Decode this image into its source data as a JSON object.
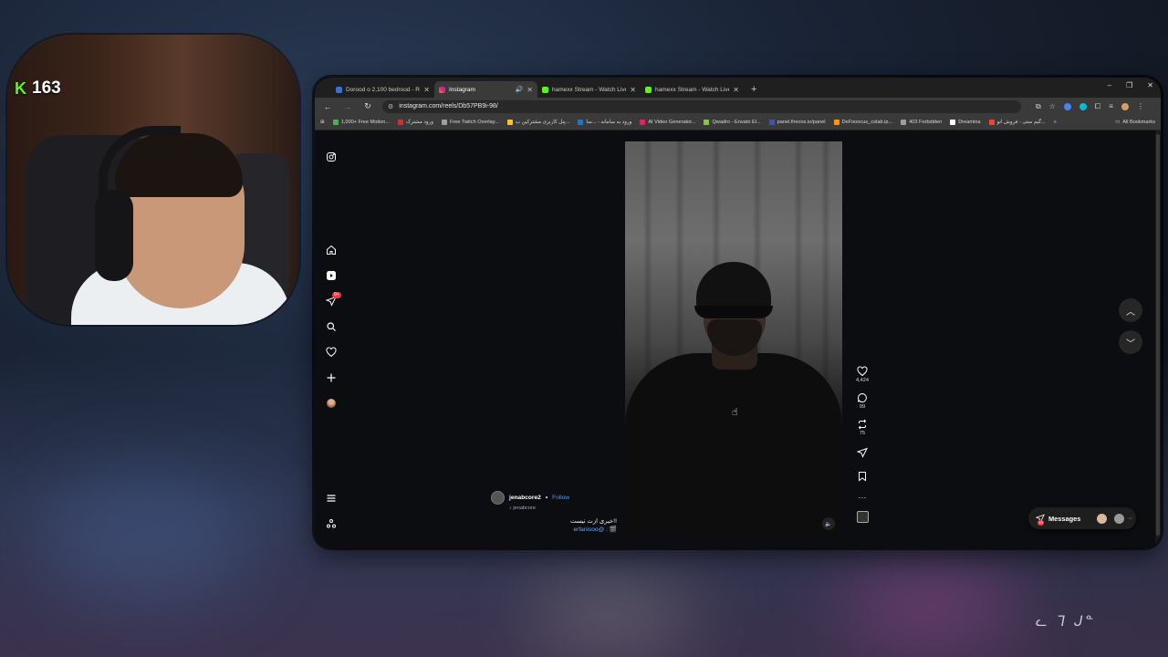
{
  "stream_overlay": {
    "viewer_count": "163",
    "kick_logo": "K",
    "corner_watermark": "ᓚ ᒣ ᒍᓐ"
  },
  "browser": {
    "tabs": [
      {
        "label": "Dorood o 2,100 bedrood - Re...",
        "favicon_color": "#3b6fd6",
        "active": false
      },
      {
        "label": "Instagram",
        "favicon_color": "#e1306c",
        "active": true
      },
      {
        "label": "hamexx Stream - Watch Live o...",
        "favicon_color": "#53fc18",
        "active": false
      },
      {
        "label": "hamexx Stream - Watch Live o...",
        "favicon_color": "#53fc18",
        "active": false
      }
    ],
    "url": "instagram.com/reels/Db57PB9i-98/",
    "bookmarks": [
      {
        "label": "1,000+ Free Motion...",
        "color": "#4caf50"
      },
      {
        "label": "ورود مشترک",
        "color": "#d32f2f"
      },
      {
        "label": "Free Twitch Overlay...",
        "color": "#9e9e9e"
      },
      {
        "label": "پنل کاربری مشترکین ب...",
        "color": "#fbc02d"
      },
      {
        "label": "ورود به سامانه - ...سا",
        "color": "#1976d2"
      },
      {
        "label": "AI Video Generator...",
        "color": "#e91e63"
      },
      {
        "label": "Qwadro - Envato El...",
        "color": "#8bc34a"
      },
      {
        "label": "panel.firecos.io/panel",
        "color": "#3f51b5"
      },
      {
        "label": "DeFooocus_colab.ip...",
        "color": "#ff9800"
      },
      {
        "label": "403 Forbidden",
        "color": "#9e9e9e"
      },
      {
        "label": "Dreamina",
        "color": "#ffffff"
      },
      {
        "label": "گیم ستی - فروش انو...",
        "color": "#f44336"
      }
    ],
    "all_bookmarks": "All Bookmarks"
  },
  "instagram": {
    "sidebar_badge": "9+",
    "reel": {
      "username": "jenabcore2",
      "follow": "Follow",
      "audio": "jenabcore",
      "caption": "خبری ازت نیست!!",
      "mention": "erfanisoo@ : 🎬",
      "likes": "4,424",
      "comments": "99",
      "reposts": "75"
    },
    "messages": {
      "label": "Messages",
      "badge": "10"
    }
  }
}
